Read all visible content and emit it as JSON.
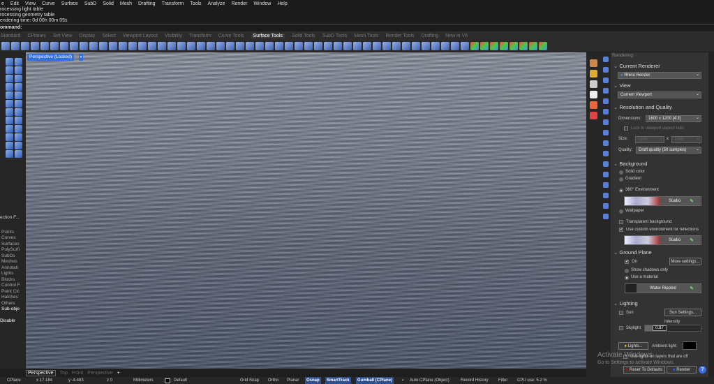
{
  "menu": [
    "e",
    "Edit",
    "View",
    "Curve",
    "Surface",
    "SubD",
    "Solid",
    "Mesh",
    "Drafting",
    "Transform",
    "Tools",
    "Analyze",
    "Render",
    "Window",
    "Help"
  ],
  "log": [
    "rocessing light table",
    "rocessing geometry table",
    "endering time: 0d 00h 00m 05s"
  ],
  "command": "ommand:",
  "toolbar_tabs": [
    "Standard",
    "CPlanes",
    "Set View",
    "Display",
    "Select",
    "Viewport Layout",
    "Visibility",
    "Transform",
    "Curve Tools",
    "Surface Tools",
    "Solid Tools",
    "SubD Tools",
    "Mesh Tools",
    "Render Tools",
    "Drafting",
    "New in V8"
  ],
  "active_tab": "Surface Tools",
  "viewport": {
    "title": "Perspective (Locked)",
    "arrow": "▾"
  },
  "filter": {
    "title": "ection F...",
    "items": [
      "Points",
      "Curves",
      "Surfaces",
      "PolySurfi",
      "SubDs",
      "Meshes",
      "Annotati",
      "Lights",
      "Blocks",
      "Control F",
      "Point Clc",
      "Hatches",
      "Others",
      "Sub-obje"
    ],
    "disable": "Disable"
  },
  "panel": {
    "title": "Rendering",
    "current_renderer": {
      "heading": "Current Renderer",
      "value": "Rhino Render"
    },
    "view": {
      "heading": "View",
      "value": "Current Viewport"
    },
    "resolution": {
      "heading": "Resolution and Quality",
      "dimensions_label": "Dimensions:",
      "dimensions": "1600 x 1200 [4:3]",
      "lock_label": "Lock to viewport aspect ratio",
      "size_label": "Size:",
      "size_w": "1600",
      "x": "x",
      "size_h": "1200",
      "quality_label": "Quality:",
      "quality": "Draft quality (50 samples)"
    },
    "background": {
      "heading": "Background",
      "solid": "Solid color",
      "gradient": "Gradient",
      "env360": "360° Environment",
      "env_name": "Studio",
      "wallpaper": "Wallpaper",
      "transparent": "Transparent background",
      "custom_env": "Use custom environment for reflections",
      "custom_env_name": "Studio"
    },
    "ground": {
      "heading": "Ground Plane",
      "on": "On",
      "more": "More settings...",
      "shadows": "Show shadows only",
      "material": "Use a material",
      "material_name": "Water Rippled"
    },
    "lighting": {
      "heading": "Lighting",
      "sun": "Sun",
      "sun_settings": "Sun Settings...",
      "intensity_label": "Intensity",
      "skylight": "Skylight",
      "intensity": "0.87",
      "lights": "Lights...",
      "ambient": "Ambient light:",
      "use_layers": "Use lights on layers that are off"
    },
    "reset": "Reset To Defaults",
    "render": "Render",
    "help": "?"
  },
  "viewport_tabs": [
    "Perspective",
    "Top",
    "Front",
    "Perspective",
    "+"
  ],
  "status": {
    "cplane": "CPlane",
    "x": "x 17.184",
    "y": "y -4.483",
    "z": "z 0",
    "units": "Millimeters",
    "layer": "Default",
    "grid_snap": "Grid Snap",
    "ortho": "Ortho",
    "planar": "Planar",
    "osnap": "Osnap",
    "smarttrack": "SmartTrack",
    "gumball": "Gumball (CPlane)",
    "auto_cplane": "Auto CPlane (Object)",
    "record": "Record History",
    "filter": "Filter",
    "cpu": "CPU use: 5.2 %"
  },
  "watermark": [
    "Activate Windows",
    "Go to Settings to activate Windows."
  ]
}
